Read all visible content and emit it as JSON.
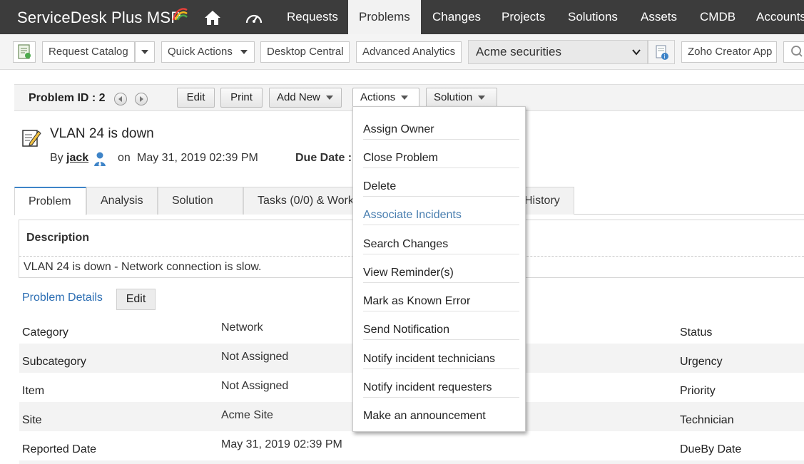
{
  "nav": {
    "brand": "ServiceDesk Plus MSP",
    "tabs": [
      "Requests",
      "Problems",
      "Changes",
      "Projects",
      "Solutions",
      "Assets",
      "CMDB",
      "Accounts"
    ],
    "active_tab": "Problems",
    "icons": [
      "home-icon",
      "dashboard-icon"
    ]
  },
  "toolbar": {
    "request_catalog": "Request Catalog",
    "quick_actions": "Quick Actions",
    "desktop_central": "Desktop Central",
    "advanced_analytics": "Advanced Analytics",
    "account": "Acme securities",
    "zoho_creator": "Zoho Creator App"
  },
  "problem": {
    "id_label": "Problem ID : 2",
    "buttons": {
      "edit": "Edit",
      "print": "Print",
      "add_new": "Add New",
      "actions": "Actions",
      "solution": "Solution"
    },
    "title": "VLAN 24 is down",
    "by_prefix": "By",
    "author": "jack",
    "on_prefix": "on",
    "created": "May 31, 2019 02:39 PM",
    "due_label": "Due Date :"
  },
  "tabs": [
    "Problem",
    "Analysis",
    "Solution",
    "Tasks (0/0) & Work",
    "History"
  ],
  "description": {
    "heading": "Description",
    "text": "VLAN 24 is down - Network connection is slow."
  },
  "details": {
    "heading": "Problem Details",
    "edit": "Edit",
    "rows": [
      {
        "label": "Category",
        "value": "Network",
        "right_label": "Status"
      },
      {
        "label": "Subcategory",
        "value": "Not Assigned",
        "right_label": "Urgency"
      },
      {
        "label": "Item",
        "value": "Not Assigned",
        "right_label": "Priority"
      },
      {
        "label": "Site",
        "value": "Acme Site",
        "right_label": "Technician"
      },
      {
        "label": "Reported Date",
        "value": "May 31, 2019 02:39 PM",
        "right_label": "DueBy Date"
      }
    ]
  },
  "actions_menu": {
    "items": [
      "Assign Owner",
      "Close Problem",
      "Delete",
      "Associate Incidents",
      "Search Changes",
      "View Reminder(s)",
      "Mark as Known Error",
      "Send Notification",
      "Notify incident technicians",
      "Notify incident requesters",
      "Make an announcement"
    ],
    "highlighted": "Associate Incidents"
  },
  "colors": {
    "nav_bg": "#3c3c3c",
    "link_blue": "#2c6eb3",
    "tab_accent": "#3e84c8"
  }
}
